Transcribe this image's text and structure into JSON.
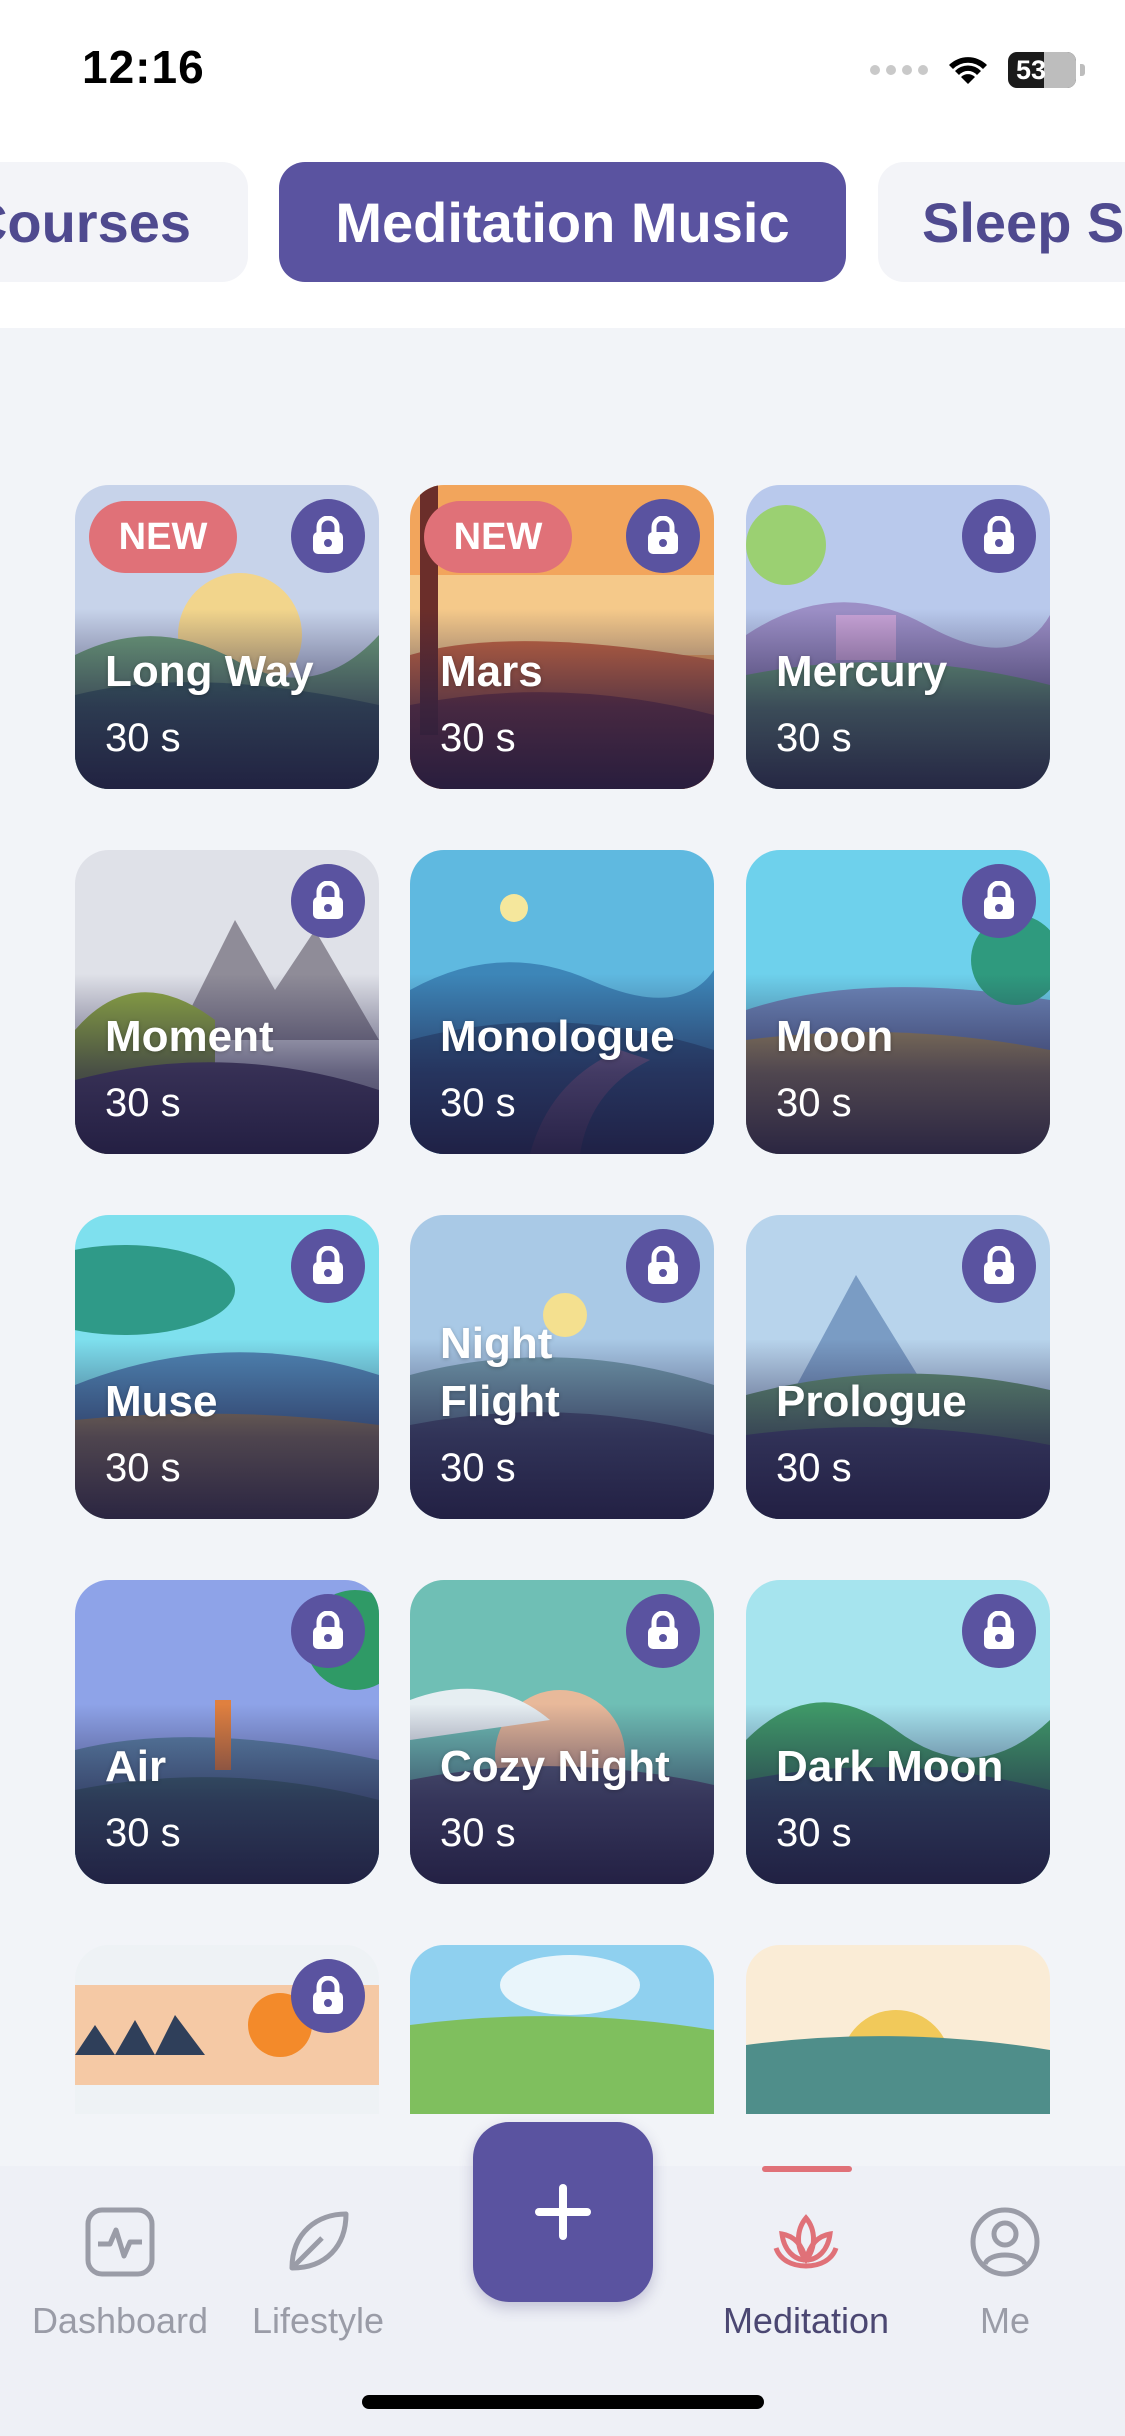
{
  "status_bar": {
    "time": "12:16",
    "battery": "53"
  },
  "tabs": [
    {
      "label": "Courses",
      "active": false
    },
    {
      "label": "Meditation Music",
      "active": true
    },
    {
      "label": "Sleep S",
      "active": false
    }
  ],
  "cards": [
    {
      "title": "Long Way",
      "duration": "30 s",
      "badge": "NEW",
      "locked": true
    },
    {
      "title": "Mars",
      "duration": "30 s",
      "badge": "NEW",
      "locked": true
    },
    {
      "title": "Mercury",
      "duration": "30 s",
      "badge": "",
      "locked": true
    },
    {
      "title": "Moment",
      "duration": "30 s",
      "badge": "",
      "locked": true
    },
    {
      "title": "Monologue",
      "duration": "30 s",
      "badge": "",
      "locked": false
    },
    {
      "title": "Moon",
      "duration": "30 s",
      "badge": "",
      "locked": true
    },
    {
      "title": "Muse",
      "duration": "30 s",
      "badge": "",
      "locked": true
    },
    {
      "title": "Night Flight",
      "duration": "30 s",
      "badge": "",
      "locked": true
    },
    {
      "title": "Prologue",
      "duration": "30 s",
      "badge": "",
      "locked": true
    },
    {
      "title": "Air",
      "duration": "30 s",
      "badge": "",
      "locked": true
    },
    {
      "title": "Cozy Night",
      "duration": "30 s",
      "badge": "",
      "locked": true
    },
    {
      "title": "Dark Moon",
      "duration": "30 s",
      "badge": "",
      "locked": true
    },
    {
      "title": "",
      "duration": "",
      "badge": "",
      "locked": true
    },
    {
      "title": "",
      "duration": "",
      "badge": "",
      "locked": false
    },
    {
      "title": "",
      "duration": "",
      "badge": "",
      "locked": false
    }
  ],
  "nav": {
    "items": [
      {
        "label": "Dashboard",
        "icon": "pulse-icon",
        "active": false
      },
      {
        "label": "Lifestyle",
        "icon": "leaf-icon",
        "active": false
      },
      {
        "label": "Meditation",
        "icon": "lotus-icon",
        "active": true
      },
      {
        "label": "Me",
        "icon": "profile-icon",
        "active": false
      }
    ],
    "add_icon": "plus-icon"
  },
  "colors": {
    "accent": "#5a53a0",
    "badge": "#e07178",
    "nav_inactive": "#9a9ca7",
    "background": "#f2f4f8"
  }
}
